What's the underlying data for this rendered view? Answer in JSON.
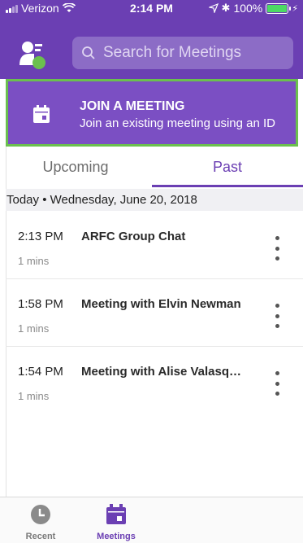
{
  "status_bar": {
    "carrier": "Verizon",
    "time": "2:14 PM",
    "battery": "100%"
  },
  "search": {
    "placeholder": "Search for Meetings"
  },
  "join_banner": {
    "title": "JOIN A MEETING",
    "subtitle": "Join an existing meeting using an ID"
  },
  "tabs": [
    {
      "label": "Upcoming",
      "active": false
    },
    {
      "label": "Past",
      "active": true
    }
  ],
  "date_header": "Today • Wednesday, June 20, 2018",
  "meetings": [
    {
      "time": "2:13 PM",
      "title": "ARFC Group Chat",
      "duration": "1 mins"
    },
    {
      "time": "1:58 PM",
      "title": "Meeting with Elvin Newman",
      "duration": "1 mins"
    },
    {
      "time": "1:54 PM",
      "title": "Meeting with Alise Valasq…",
      "duration": "1 mins"
    }
  ],
  "bottom_nav": [
    {
      "label": "Recent",
      "icon": "clock-icon",
      "active": false
    },
    {
      "label": "Meetings",
      "icon": "calendar-icon",
      "active": true
    }
  ],
  "colors": {
    "brand_purple": "#6b3fb3",
    "banner_purple": "#7b4fc3",
    "highlight_green": "#6bbf4e",
    "battery_green": "#4cd964"
  }
}
